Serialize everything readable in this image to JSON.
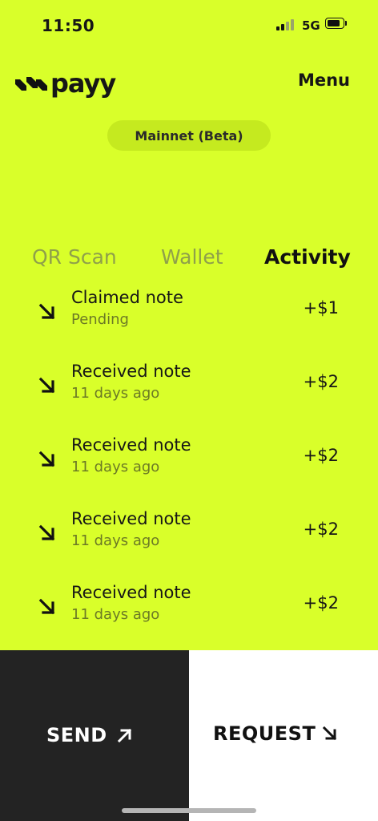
{
  "status_bar": {
    "time": "11:50",
    "network": "5G"
  },
  "header": {
    "logo_text": "payy",
    "menu_label": "Menu"
  },
  "network_pill": "Mainnet (Beta)",
  "tabs": [
    {
      "label": "QR Scan",
      "active": false
    },
    {
      "label": "Wallet",
      "active": false
    },
    {
      "label": "Activity",
      "active": true
    }
  ],
  "activity": [
    {
      "title": "Claimed note",
      "subtitle": "Pending",
      "amount": "+$1",
      "icon": "arrow-down-right-icon"
    },
    {
      "title": "Received note",
      "subtitle": "11 days ago",
      "amount": "+$2",
      "icon": "arrow-down-right-icon"
    },
    {
      "title": "Received note",
      "subtitle": "11 days ago",
      "amount": "+$2",
      "icon": "arrow-down-right-icon"
    },
    {
      "title": "Received note",
      "subtitle": "11 days ago",
      "amount": "+$2",
      "icon": "arrow-down-right-icon"
    },
    {
      "title": "Received note",
      "subtitle": "11 days ago",
      "amount": "+$2",
      "icon": "arrow-down-right-icon"
    }
  ],
  "actions": {
    "send_label": "SEND",
    "send_icon": "arrow-up-right-icon",
    "request_label": "REQUEST",
    "request_icon": "arrow-down-right-icon"
  },
  "colors": {
    "accent": "#d9ff2a",
    "pill": "#c5ea1f",
    "dark": "#232323",
    "inactive_tab": "#8fa04a"
  }
}
